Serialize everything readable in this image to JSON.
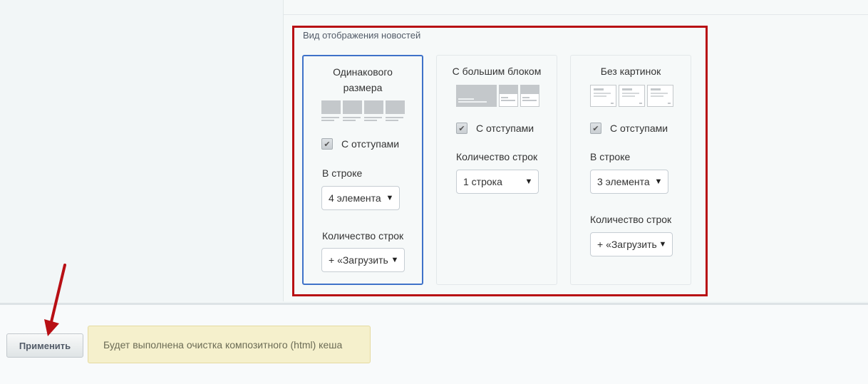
{
  "section": {
    "title": "Вид отображения новостей"
  },
  "cards": [
    {
      "title": "Одинакового размера",
      "checkbox_label": "С отступами",
      "per_row_label": "В строке",
      "per_row_value": "4 элемента",
      "rows_label": "Количество строк",
      "rows_value": "+ «Загрузить»"
    },
    {
      "title": "С большим блоком",
      "checkbox_label": "С отступами",
      "rows_label": "Количество строк",
      "rows_value": "1 строка"
    },
    {
      "title": "Без картинок",
      "checkbox_label": "С отступами",
      "per_row_label": "В строке",
      "per_row_value": "3 элемента",
      "rows_label": "Количество строк",
      "rows_value": "+ «Загрузить»"
    }
  ],
  "footer": {
    "apply_label": "Применить",
    "notice": "Будет выполнена очистка композитного (html) кеша"
  },
  "colors": {
    "highlight_border": "#b80f14",
    "selected_card_border": "#3f72c9",
    "arrow": "#b80f14",
    "notice_bg": "#f5f0cc"
  }
}
